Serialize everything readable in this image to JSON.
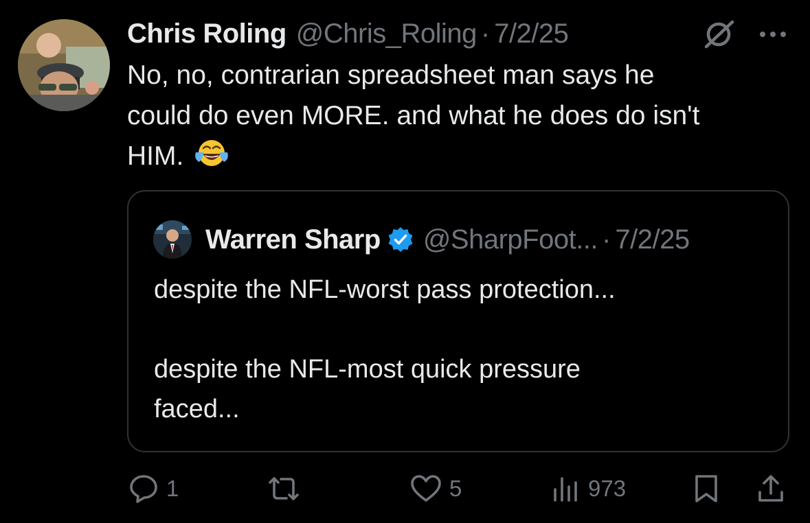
{
  "tweet": {
    "author_name": "Chris Roling",
    "author_handle": "@Chris_Roling",
    "separator": "·",
    "date": "7/2/25",
    "text_lines": [
      "No, no, contrarian spreadsheet man says he",
      "could do even MORE. and what he does do isn't",
      "HIM."
    ],
    "emoji": "face-with-tears-of-joy"
  },
  "quoted": {
    "author_name": "Warren Sharp",
    "verified": true,
    "author_handle": "@SharpFoot...",
    "separator": "·",
    "date": "7/2/25",
    "para1": "despite the NFL-worst pass protection...",
    "para2_lines": [
      "despite the NFL-most quick pressure",
      "faced..."
    ]
  },
  "actions": {
    "replies": "1",
    "retweets": "",
    "likes": "5",
    "views": "973"
  },
  "colors": {
    "background": "#000000",
    "text": "#e7e9ea",
    "muted": "#71767b",
    "border": "#2f3336",
    "verified": "#1d9bf0"
  }
}
